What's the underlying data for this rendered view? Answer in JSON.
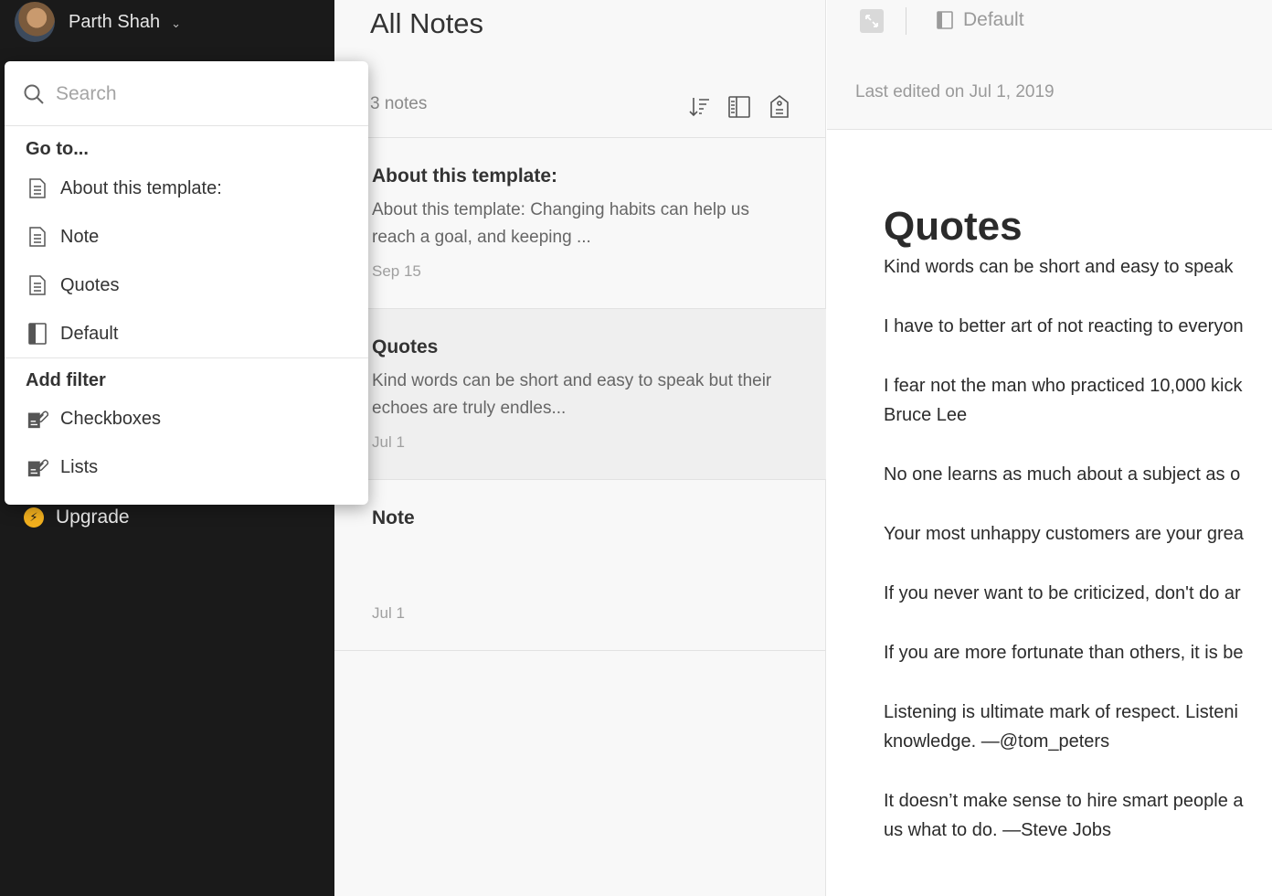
{
  "sidebar": {
    "user": {
      "name": "Parth Shah"
    },
    "upgrade_label": "Upgrade"
  },
  "popover": {
    "search_placeholder": "Search",
    "goto_heading": "Go to...",
    "goto_items": [
      {
        "label": "About this template:",
        "icon": "note-icon"
      },
      {
        "label": "Note",
        "icon": "note-icon"
      },
      {
        "label": "Quotes",
        "icon": "note-icon"
      },
      {
        "label": "Default",
        "icon": "notebook-icon"
      }
    ],
    "filter_heading": "Add filter",
    "filter_items": [
      {
        "label": "Checkboxes",
        "icon": "attachment-filter-icon"
      },
      {
        "label": "Lists",
        "icon": "attachment-filter-icon"
      }
    ]
  },
  "note_list": {
    "title": "All Notes",
    "count": "3 notes",
    "notes": [
      {
        "title": "About this template:",
        "snippet": "About this template: Changing habits can help us reach a goal, and keeping ...",
        "date": "Sep 15"
      },
      {
        "title": "Quotes",
        "snippet": "Kind words can be short and easy to speak but their echoes are truly endles...",
        "date": "Jul 1"
      },
      {
        "title": "Note",
        "snippet": "",
        "date": "Jul 1"
      }
    ]
  },
  "editor": {
    "notebook": "Default",
    "last_edited": "Last edited on Jul 1, 2019",
    "title": "Quotes",
    "paragraphs": [
      [
        "Kind words can be short and easy to speak"
      ],
      [
        "I have to better art of not reacting to everyon"
      ],
      [
        "I fear not the man who practiced 10,000 kick",
        "Bruce Lee"
      ],
      [
        "No one learns as much about a subject as o"
      ],
      [
        "Your most unhappy customers are your grea"
      ],
      [
        "If you never want to be criticized, don't do ar"
      ],
      [
        "If you are more fortunate than others, it is be"
      ],
      [
        "Listening is ultimate mark of respect. Listeni",
        "knowledge. —@tom_peters"
      ],
      [
        "It doesn’t make sense to hire smart people a",
        "us what to do. —Steve Jobs"
      ]
    ]
  },
  "colors": {
    "sidebar_bg": "#1a1a1a",
    "upgrade_accent": "#f2b01e",
    "selected_note_bg": "#efefef"
  }
}
